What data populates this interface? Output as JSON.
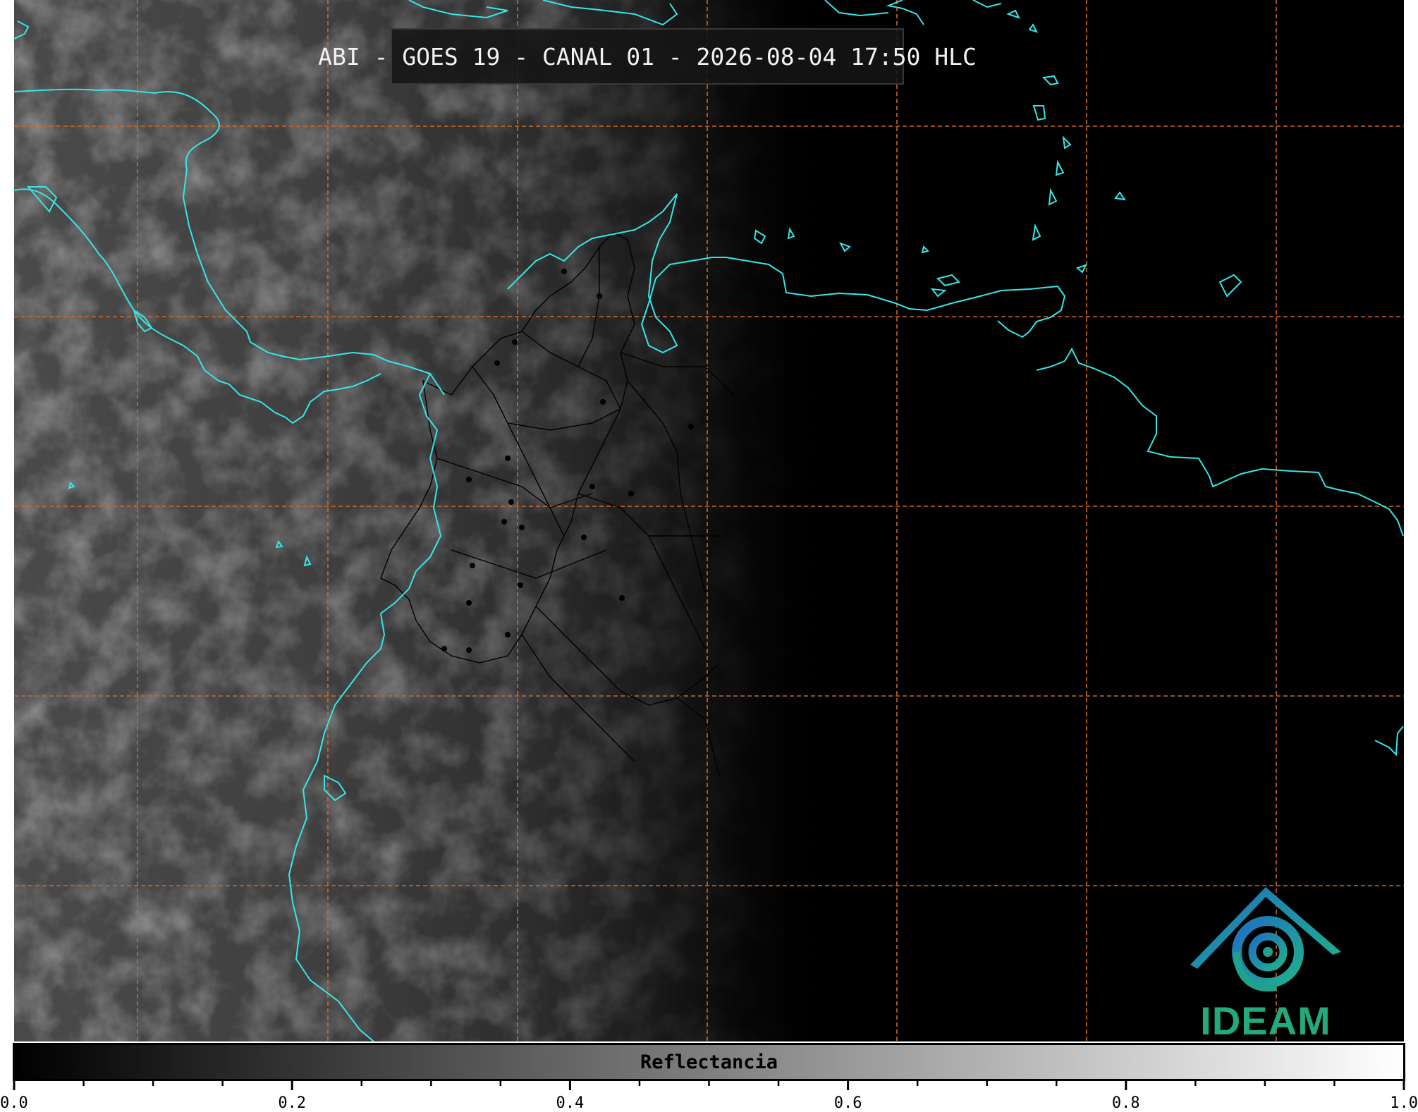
{
  "title": "ABI - GOES 19 - CANAL 01 - 2026-08-04 17:50 HLC",
  "logo": {
    "text": "IDEAM",
    "colors": {
      "arc": "#1f7fb8",
      "swirl": "#1fa28c",
      "text": "#22aa7a"
    }
  },
  "colorbar": {
    "label": "Reflectancia",
    "range": [
      0.0,
      1.0
    ],
    "major_ticks": [
      "0.0",
      "0.2",
      "0.4",
      "0.6",
      "0.8",
      "1.0"
    ],
    "minor_tick_step": 0.05,
    "colormap": "grayscale"
  },
  "map": {
    "grid_color": "#d2691e",
    "coastline_color": "#35e6e6",
    "border_color": "#000000",
    "graticule": "dashed"
  }
}
